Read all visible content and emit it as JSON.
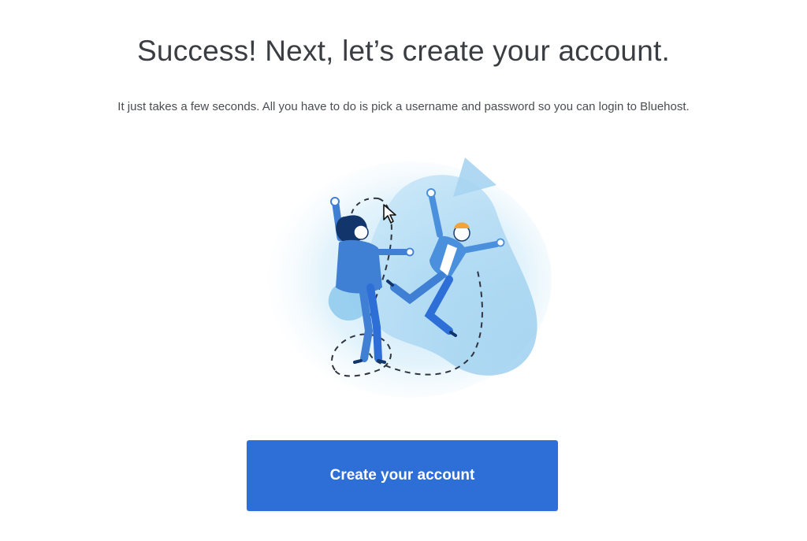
{
  "header": {
    "title": "Success! Next, let’s create your account.",
    "subtitle": "It just takes a few seconds. All you have to do is pick a username and password so you can login to Bluehost."
  },
  "illustration": {
    "icon": "celebrating-people-illustration",
    "accent": "#2e6fd7",
    "light_blue": "#a9d6f2"
  },
  "cursor": {
    "icon": "mouse-pointer-icon"
  },
  "cta": {
    "label": "Create your account",
    "color": "#2e6fd7"
  }
}
